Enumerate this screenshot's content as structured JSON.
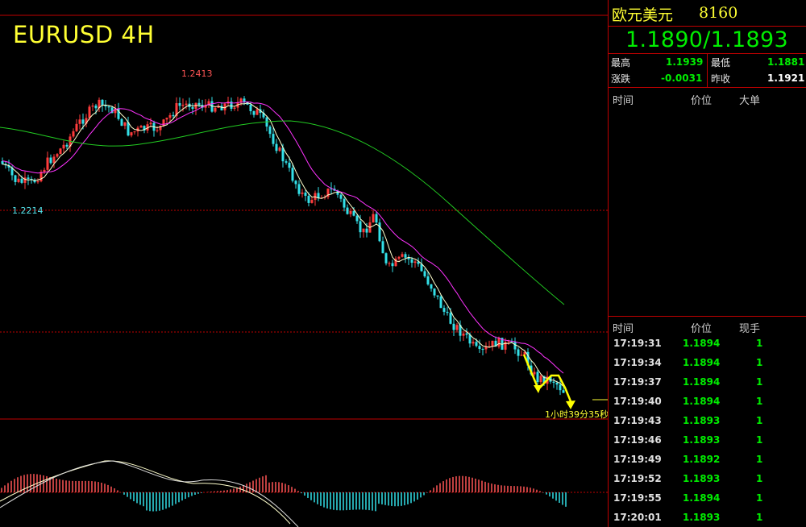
{
  "chart": {
    "symbol_title": "EURUSD 4H",
    "high_label": "1.2413",
    "low_label": "1.2214",
    "countdown": "1小时39分35秒",
    "colors": {
      "up": "#ff3b3b",
      "down": "#33e0e8",
      "ma_fast": "#ffffcc",
      "ma_mid": "#ff33ff",
      "ma_slow": "#22cc22",
      "grid": "#c00000",
      "arrow": "#ffff00",
      "title": "#ffff33"
    },
    "icons": [
      "trend-arrow-icon"
    ]
  },
  "quote_panel": {
    "name": "欧元美元",
    "code": "8160",
    "bid_ask": "1.1890/1.1893",
    "stats": {
      "high_label": "最高",
      "high_value": "1.1939",
      "low_label": "最低",
      "low_value": "1.1881",
      "change_label": "涨跌",
      "change_value": "-0.0031",
      "prev_close_label": "昨收",
      "prev_close_value": "1.1921"
    },
    "big_orders_header": {
      "time": "时间",
      "price": "价位",
      "size": "大单"
    },
    "ticks_header": {
      "time": "时间",
      "price": "价位",
      "volume": "现手"
    },
    "ticks": [
      {
        "time": "17:19:31",
        "price": "1.1894",
        "volume": "1"
      },
      {
        "time": "17:19:34",
        "price": "1.1894",
        "volume": "1"
      },
      {
        "time": "17:19:37",
        "price": "1.1894",
        "volume": "1"
      },
      {
        "time": "17:19:40",
        "price": "1.1894",
        "volume": "1"
      },
      {
        "time": "17:19:43",
        "price": "1.1893",
        "volume": "1"
      },
      {
        "time": "17:19:46",
        "price": "1.1893",
        "volume": "1"
      },
      {
        "time": "17:19:49",
        "price": "1.1892",
        "volume": "1"
      },
      {
        "time": "17:19:52",
        "price": "1.1893",
        "volume": "1"
      },
      {
        "time": "17:19:55",
        "price": "1.1894",
        "volume": "1"
      },
      {
        "time": "17:20:01",
        "price": "1.1893",
        "volume": "1"
      }
    ]
  }
}
